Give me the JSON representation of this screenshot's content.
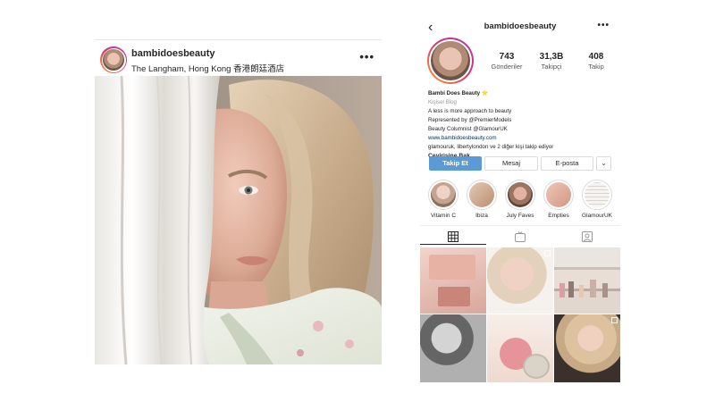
{
  "post": {
    "username": "bambidoesbeauty",
    "location": "The Langham, Hong Kong 香港朗廷酒店",
    "more_icon": "•••"
  },
  "profile": {
    "back_icon": "‹",
    "username": "bambidoesbeauty",
    "more_icon": "•••",
    "stats": [
      {
        "value": "743",
        "label": "Gönderiler"
      },
      {
        "value": "31,3B",
        "label": "Takipçi"
      },
      {
        "value": "408",
        "label": "Takip"
      }
    ],
    "bio": {
      "name": "Bambi Does Beauty ⭐",
      "category": "Kişisel Blog",
      "line1": "A less is more approach to beauty",
      "line2": "Represented by @PremierModels",
      "line3": "Beauty Columnist @GlamourUK",
      "link": "www.bambidoesbeauty.com",
      "followed_by": "glamouruk, libertylondon ve 2 diğer kişi takip ediyor",
      "translate": "Çevirisine Bak"
    },
    "buttons": {
      "follow": "Takip Et",
      "message": "Mesaj",
      "email": "E-posta",
      "dropdown": "⌄"
    },
    "highlights": [
      {
        "label": "Vitamin C",
        "color": "#d9c3b7"
      },
      {
        "label": "Ibiza",
        "color": "#c9a58c"
      },
      {
        "label": "July Faves",
        "color": "#b78d7a"
      },
      {
        "label": "Empties",
        "color": "#e3b6a6"
      },
      {
        "label": "GlamourUK",
        "color": "#f3f1ee"
      }
    ],
    "tab_icons": [
      "grid-icon",
      "igtv-icon",
      "tagged-icon"
    ],
    "accent_color": "#5b9bd5"
  }
}
